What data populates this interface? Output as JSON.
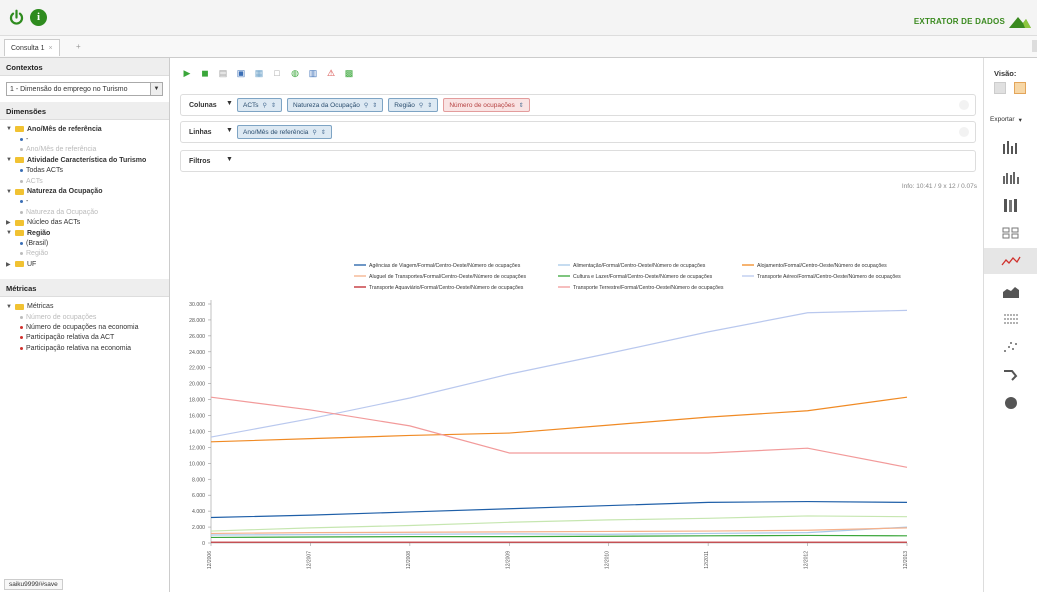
{
  "app": {
    "brand": "EXTRATOR DE DADOS"
  },
  "tabs": [
    {
      "label": "Consulta 1",
      "close": "×"
    }
  ],
  "tab_add": "+",
  "left": {
    "contextos_title": "Contextos",
    "cube_selected": "1 - Dimensão do emprego no Turismo",
    "dimensoes_title": "Dimensões",
    "tree": [
      {
        "kind": "folder",
        "label": "Ano/Mês de referência",
        "open": true,
        "bold": true
      },
      {
        "kind": "item",
        "label": "-",
        "dot": "blue"
      },
      {
        "kind": "item",
        "label": "Ano/Mês de referência",
        "dot": "grey",
        "muted": true
      },
      {
        "kind": "folder",
        "label": "Atividade Característica do Turismo",
        "open": true,
        "bold": true
      },
      {
        "kind": "item",
        "label": "Todas ACTs",
        "dot": "blue"
      },
      {
        "kind": "item",
        "label": "ACTs",
        "dot": "grey",
        "muted": true
      },
      {
        "kind": "folder",
        "label": "Natureza da Ocupação",
        "open": true,
        "bold": true
      },
      {
        "kind": "item",
        "label": "-",
        "dot": "blue"
      },
      {
        "kind": "item",
        "label": "Natureza da Ocupação",
        "dot": "grey",
        "muted": true
      },
      {
        "kind": "folder",
        "label": "Núcleo das ACTs",
        "open": false,
        "bold": false
      },
      {
        "kind": "folder",
        "label": "Região",
        "open": true,
        "bold": true
      },
      {
        "kind": "item",
        "label": "(Brasil)",
        "dot": "blue"
      },
      {
        "kind": "item",
        "label": "Região",
        "dot": "grey",
        "muted": true
      },
      {
        "kind": "folder",
        "label": "UF",
        "open": false,
        "bold": false
      }
    ],
    "metricas_title": "Métricas",
    "metric_tree": [
      {
        "kind": "folder",
        "label": "Métricas",
        "open": true,
        "bold": false
      },
      {
        "kind": "item",
        "label": "Número de ocupações",
        "dot": "grey",
        "muted": true
      },
      {
        "kind": "item",
        "label": "Número de ocupações na economia",
        "dot": "red"
      },
      {
        "kind": "item",
        "label": "Participação relativa da ACT",
        "dot": "red"
      },
      {
        "kind": "item",
        "label": "Participação relativa na economia",
        "dot": "red"
      }
    ],
    "status": "saiku9999/#save"
  },
  "shelves": {
    "colunas_label": "Colunas",
    "colunas": [
      {
        "label": "ACTs",
        "type": "dim"
      },
      {
        "label": "Natureza da Ocupação",
        "type": "dim"
      },
      {
        "label": "Região",
        "type": "dim"
      },
      {
        "label": "Número de ocupações",
        "type": "metric"
      }
    ],
    "linhas_label": "Linhas",
    "linhas": [
      {
        "label": "Ano/Mês de referência",
        "type": "dim"
      }
    ],
    "filtros_label": "Filtros"
  },
  "info": "Info: 10:41  /  9 x 12  /  0.07s",
  "right": {
    "visao": "Visão:",
    "exportar": "Exportar"
  },
  "chart_data": {
    "type": "line",
    "x": [
      "12/2006",
      "12/2007",
      "12/2008",
      "12/2009",
      "12/2010",
      "12/2011",
      "12/2012",
      "12/2013"
    ],
    "ylim": [
      0,
      30000
    ],
    "yticks": [
      "0",
      "2.000",
      "4.000",
      "6.000",
      "8.000",
      "10.000",
      "12.000",
      "14.000",
      "16.000",
      "18.000",
      "20.000",
      "22.000",
      "24.000",
      "26.000",
      "28.000",
      "30.000"
    ],
    "series": [
      {
        "name": "Agências de Viagem/Formal/Centro-Oeste/Número de ocupações",
        "color": "#1f5fa8",
        "values": [
          3200,
          3500,
          3900,
          4300,
          4700,
          5100,
          5200,
          5100
        ]
      },
      {
        "name": "Alimentação/Formal/Centro-Oeste/Número de ocupações",
        "color": "#a8c8e8",
        "values": [
          1000,
          1050,
          1100,
          1150,
          1100,
          1200,
          1300,
          2000
        ]
      },
      {
        "name": "Alojamento/Formal/Centro-Oeste/Número de ocupações",
        "color": "#f08a24",
        "values": [
          12700,
          13100,
          13500,
          13800,
          14800,
          15800,
          16600,
          18300
        ]
      },
      {
        "name": "Aluguel de Transportes/Formal/Centro-Oeste/Número de ocupações",
        "color": "#f5b08a",
        "values": [
          1200,
          1300,
          1350,
          1400,
          1450,
          1500,
          1600,
          1900
        ]
      },
      {
        "name": "Cultura e Lazer/Formal/Centro-Oeste/Número de ocupações",
        "color": "#3aa63a",
        "values": [
          700,
          750,
          800,
          800,
          850,
          900,
          950,
          900
        ]
      },
      {
        "name": "Transporte Aéreo/Formal/Centro-Oeste/Número de ocupações",
        "color": "#b9c8ee",
        "values": [
          13300,
          15600,
          18200,
          21200,
          23800,
          26500,
          28900,
          29200
        ]
      },
      {
        "name": "Transporte Aquaviário/Formal/Centro-Oeste/Número de ocupações",
        "color": "#c0272d",
        "values": [
          100,
          100,
          100,
          100,
          100,
          100,
          100,
          100
        ]
      },
      {
        "name": "Transporte Terrestre/Formal/Centro-Oeste/Número de ocupações",
        "color": "#f29a9a",
        "values": [
          18300,
          16700,
          14700,
          11300,
          11300,
          11300,
          11900,
          9500
        ]
      },
      {
        "name": "",
        "color": "#c6e6b0",
        "values": [
          1500,
          1900,
          2200,
          2600,
          2900,
          3100,
          3400,
          3300
        ]
      }
    ]
  }
}
